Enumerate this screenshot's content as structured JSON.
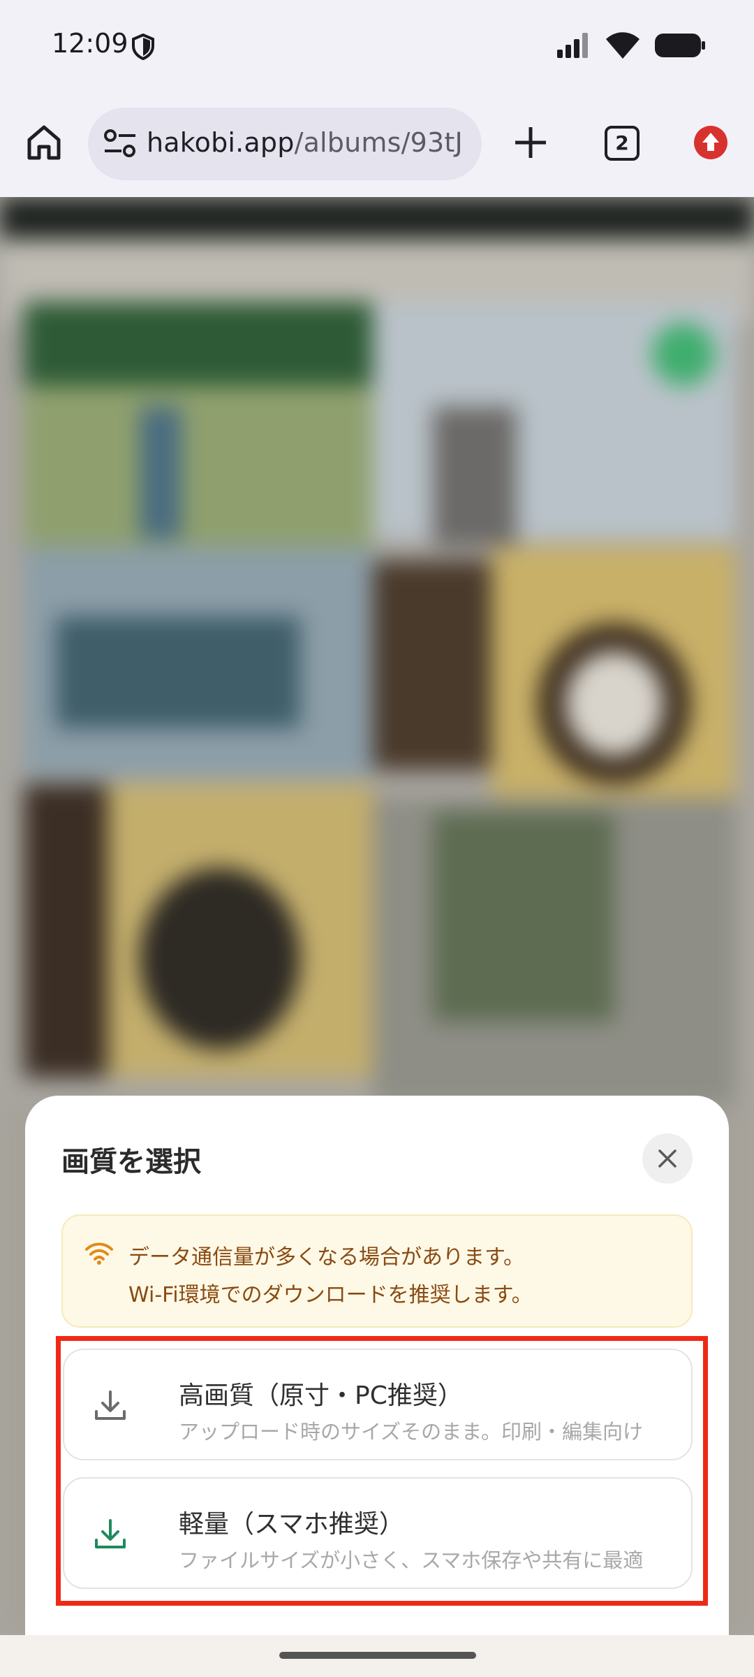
{
  "status_bar": {
    "time": "12:09"
  },
  "browser": {
    "url_host": "hakobi.app",
    "url_path": "/albums/93tJ",
    "tab_count": "2"
  },
  "sheet": {
    "title": "画質を選択",
    "notice": {
      "line1": "データ通信量が多くなる場合があります。",
      "line2": "Wi-Fi環境でのダウンロードを推奨します。"
    },
    "options": [
      {
        "title": "高画質（原寸・PC推奨）",
        "description": "アップロード時のサイズそのまま。印刷・編集向け",
        "icon": "download-icon",
        "icon_color": "#6b6b6b"
      },
      {
        "title": "軽量（スマホ推奨）",
        "description": "ファイルサイズが小さく、スマホ保存や共有に最適",
        "icon": "download-icon",
        "icon_color": "#1f8a5c"
      }
    ]
  },
  "colors": {
    "highlight": "#ee2a16",
    "notice_text": "#8a4a12",
    "notice_icon": "#e08a1a",
    "update_badge": "#d8322f"
  }
}
